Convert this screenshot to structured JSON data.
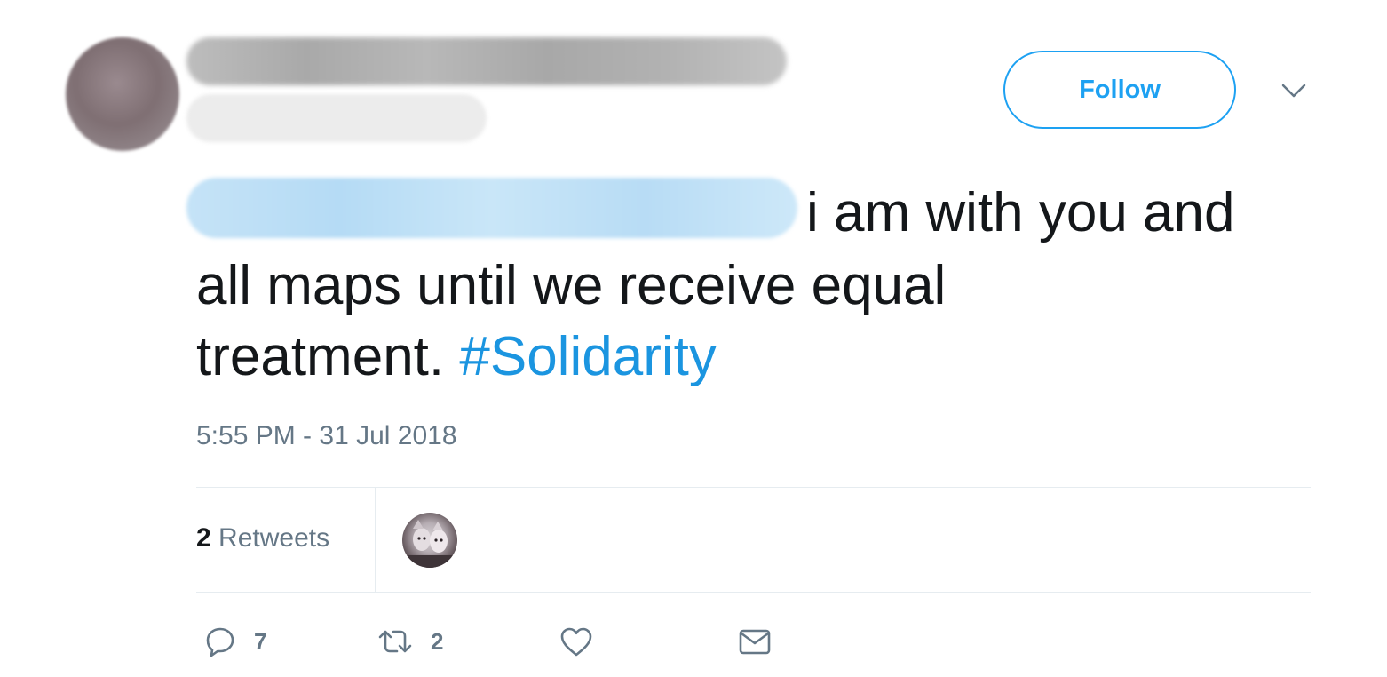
{
  "header": {
    "follow_label": "Follow"
  },
  "tweet": {
    "line1": "i am with you and",
    "line2": "all maps until we receive equal",
    "line3_text": "treatment. ",
    "hashtag": "#Solidarity",
    "timestamp": "5:55 PM - 31 Jul 2018"
  },
  "stats": {
    "retweet_count": "2",
    "retweet_label": "Retweets"
  },
  "actions": {
    "reply_count": "7",
    "retweet_count": "2"
  },
  "colors": {
    "accent": "#1da1f2",
    "hashtag": "#1b95e0",
    "text": "#14171a",
    "muted": "#657786",
    "divider": "#e6ecf0"
  },
  "icons": {
    "reply": "reply-icon",
    "retweet": "retweet-icon",
    "like": "heart-icon",
    "dm": "envelope-icon",
    "caret": "chevron-down-icon"
  }
}
